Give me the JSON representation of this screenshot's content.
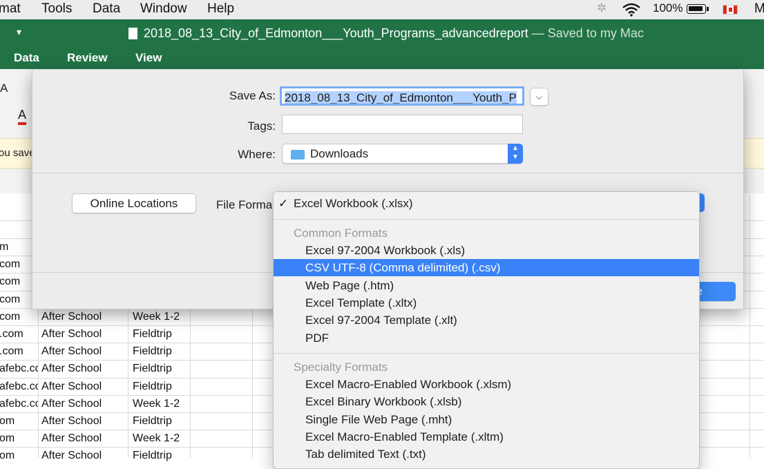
{
  "menubar": {
    "items": [
      "mat",
      "Tools",
      "Data",
      "Window",
      "Help"
    ],
    "battery": "100%",
    "user_initial": "M"
  },
  "window": {
    "title": "2018_08_13_City_of_Edmonton___Youth_Programs_advancedreport",
    "saved_status": "— Saved to my Mac"
  },
  "ribbon_tabs": [
    "Data",
    "Review",
    "View"
  ],
  "toolbar": {
    "font_size_label": "A",
    "font_color_label": "A",
    "notice_text": "ou save"
  },
  "dialog": {
    "save_as_label": "Save As:",
    "save_as_value": "2018_08_13_City_of_Edmonton___Youth_P",
    "tags_label": "Tags:",
    "tags_value": "",
    "where_label": "Where:",
    "where_value": "Downloads",
    "online_locations_label": "Online Locations",
    "file_format_label": "File Forma",
    "save_button_label": "ve"
  },
  "format_menu": {
    "checked_item": "Excel Workbook (.xlsx)",
    "common_header": "Common Formats",
    "common_items": [
      "Excel 97-2004 Workbook (.xls)",
      "CSV UTF-8 (Comma delimited) (.csv)",
      "Web Page (.htm)",
      "Excel Template (.xltx)",
      "Excel 97-2004 Template (.xlt)",
      "PDF"
    ],
    "selected_item": "CSV UTF-8 (Comma delimited) (.csv)",
    "specialty_header": "Specialty Formats",
    "specialty_items": [
      "Excel Macro-Enabled Workbook (.xlsm)",
      "Excel Binary Workbook (.xlsb)",
      "Single File Web Page (.mht)",
      "Excel Macro-Enabled Template (.xltm)",
      "Tab delimited Text (.txt)"
    ]
  },
  "sheet": {
    "rows": [
      [
        "m",
        "",
        ""
      ],
      [
        "com",
        "",
        ""
      ],
      [
        "com",
        "",
        ""
      ],
      [
        "com",
        "",
        ""
      ],
      [
        "com",
        "After School",
        "Week 1-2"
      ],
      [
        ".com",
        "After School",
        "Fieldtrip"
      ],
      [
        ".com",
        "After School",
        "Fieldtrip"
      ],
      [
        "afebc.co",
        "After School",
        "Fieldtrip"
      ],
      [
        "afebc.co",
        "After School",
        "Fieldtrip"
      ],
      [
        "afebc.co",
        "After School",
        "Week 1-2"
      ],
      [
        "om",
        "After School",
        "Fieldtrip"
      ],
      [
        "om",
        "After School",
        "Week 1-2"
      ],
      [
        "om",
        "After School",
        "Fieldtrip"
      ]
    ]
  },
  "colors": {
    "excel_green": "#217346",
    "selection_blue": "#3a82f7"
  }
}
